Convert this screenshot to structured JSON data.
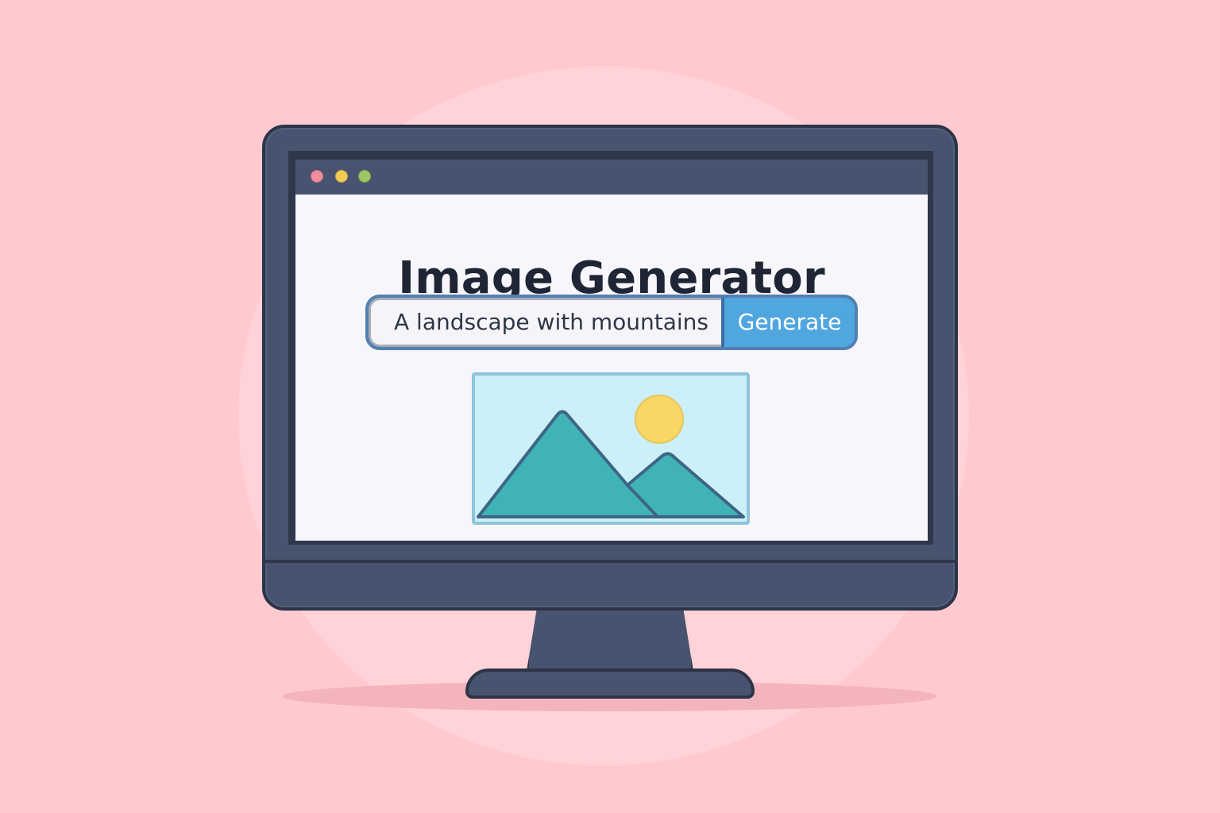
{
  "app": {
    "title": "Image Generator"
  },
  "window": {
    "controls": [
      "close",
      "minimize",
      "maximize"
    ]
  },
  "search": {
    "value": "A landscape with mountains",
    "button_label": "Generate"
  },
  "preview": {
    "icon": "landscape-image-icon",
    "sun_icon": "sun-icon",
    "mountain_icon": "mountain-icon"
  },
  "colors": {
    "background": "#ffc9d0",
    "monitor": "#47536f",
    "screen": "#f7f6fb",
    "button": "#50a6df",
    "mountain": "#40b3b6",
    "sun": "#f9d767"
  }
}
